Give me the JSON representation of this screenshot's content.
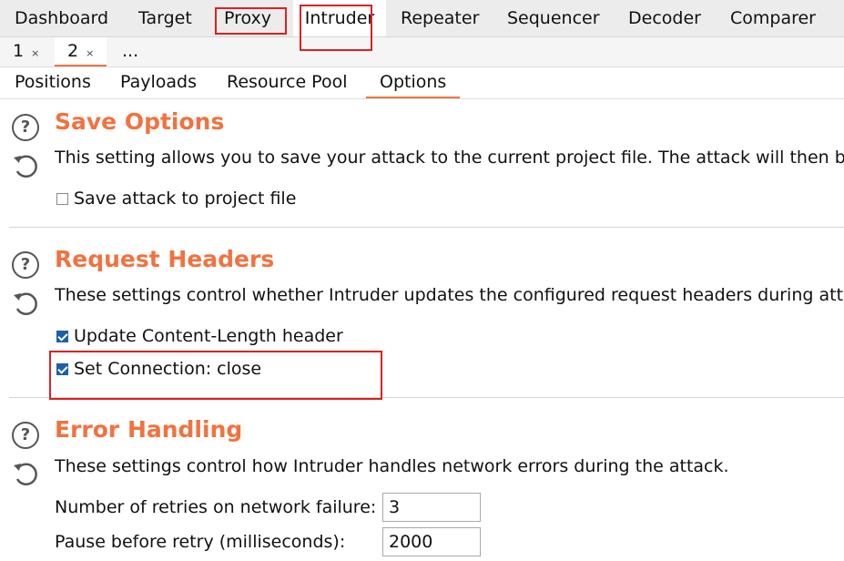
{
  "main_tabs": [
    "Dashboard",
    "Target",
    "Proxy",
    "Intruder",
    "Repeater",
    "Sequencer",
    "Decoder",
    "Comparer"
  ],
  "attack_tabs": {
    "tab1": "1",
    "tab2": "2",
    "close": "×",
    "more": "..."
  },
  "option_tabs": [
    "Positions",
    "Payloads",
    "Resource Pool",
    "Options"
  ],
  "save_options": {
    "title": "Save Options",
    "description": "This setting allows you to save your attack to the current project file. The attack will then be",
    "checkbox": {
      "label": "Save attack to project file",
      "checked": false
    }
  },
  "request_headers": {
    "title": "Request Headers",
    "description": "These settings control whether Intruder updates the configured request headers during atta",
    "checkbox1": {
      "label": "Update Content-Length header",
      "checked": true
    },
    "checkbox2": {
      "label": "Set Connection: close",
      "checked": true
    }
  },
  "error_handling": {
    "title": "Error Handling",
    "description": "These settings control how Intruder handles network errors during the attack.",
    "retries": {
      "label": "Number of retries on network failure:",
      "value": "3"
    },
    "pause": {
      "label": "Pause before retry (milliseconds):",
      "value": "2000"
    }
  },
  "icons": {
    "help": "?",
    "colors": {
      "accent": "#f2723f",
      "highlight_box": "#e02020",
      "checkbox": "#1f5fa8"
    }
  }
}
